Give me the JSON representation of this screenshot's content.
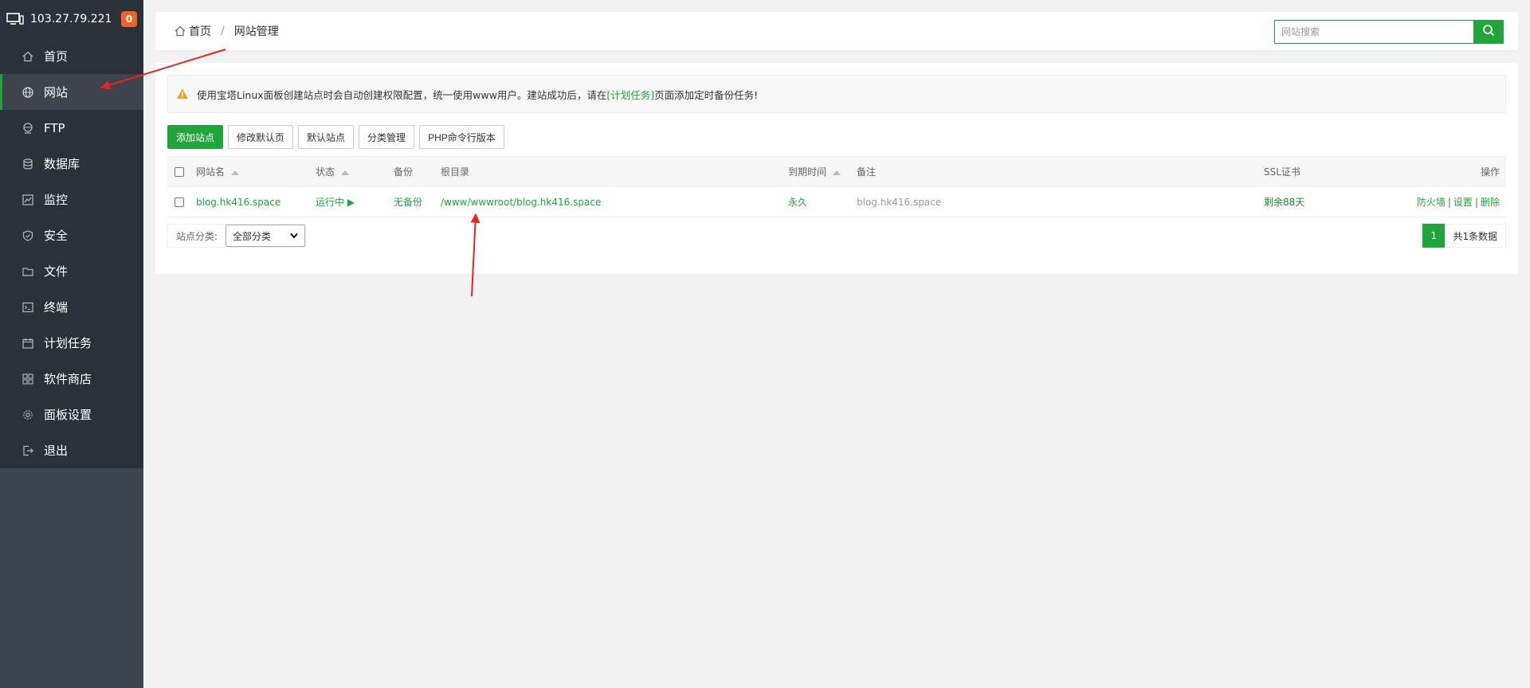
{
  "sidebar": {
    "server_ip": "103.27.79.221",
    "badge_count": "0",
    "items": [
      {
        "label": "首页",
        "icon": "home-icon"
      },
      {
        "label": "网站",
        "icon": "globe-icon",
        "active": true
      },
      {
        "label": "FTP",
        "icon": "ftp-icon"
      },
      {
        "label": "数据库",
        "icon": "database-icon"
      },
      {
        "label": "监控",
        "icon": "monitor-chart-icon"
      },
      {
        "label": "安全",
        "icon": "shield-icon"
      },
      {
        "label": "文件",
        "icon": "folder-icon"
      },
      {
        "label": "终端",
        "icon": "terminal-icon"
      },
      {
        "label": "计划任务",
        "icon": "calendar-icon"
      },
      {
        "label": "软件商店",
        "icon": "apps-grid-icon"
      },
      {
        "label": "面板设置",
        "icon": "gear-icon"
      },
      {
        "label": "退出",
        "icon": "logout-icon"
      }
    ]
  },
  "breadcrumb": {
    "home": "首页",
    "separator": "/",
    "current": "网站管理"
  },
  "search": {
    "placeholder": "网站搜索",
    "value": ""
  },
  "notice": {
    "before": "使用宝塔Linux面板创建站点时会自动创建权限配置，统一使用www用户。建站成功后，请在",
    "link": "[计划任务]",
    "after": "页面添加定时备份任务!"
  },
  "toolbar": {
    "add_site": "添加站点",
    "edit_default_page": "修改默认页",
    "default_site": "默认站点",
    "category_manage": "分类管理",
    "php_cli_version": "PHP命令行版本"
  },
  "table": {
    "headers": {
      "name": "网站名",
      "status": "状态",
      "backup": "备份",
      "root": "根目录",
      "expire": "到期时间",
      "remark": "备注",
      "ssl": "SSL证书",
      "ops": "操作"
    },
    "rows": [
      {
        "name": "blog.hk416.space",
        "status": "运行中 ▶",
        "backup": "无备份",
        "root": "/www/wwwroot/blog.hk416.space",
        "expire": "永久",
        "remark": "blog.hk416.space",
        "ssl": "剩余88天",
        "op_firewall": "防火墙",
        "op_settings": "设置",
        "op_delete": "删除",
        "op_sep": "|"
      }
    ]
  },
  "footer": {
    "category_label": "站点分类:",
    "category_selected": "全部分类",
    "current_page": "1",
    "total_text": "共1条数据"
  },
  "colors": {
    "accent": "#20a53a",
    "sidebar_bg": "#2b3138",
    "annotation_arrow": "#e8241f"
  }
}
